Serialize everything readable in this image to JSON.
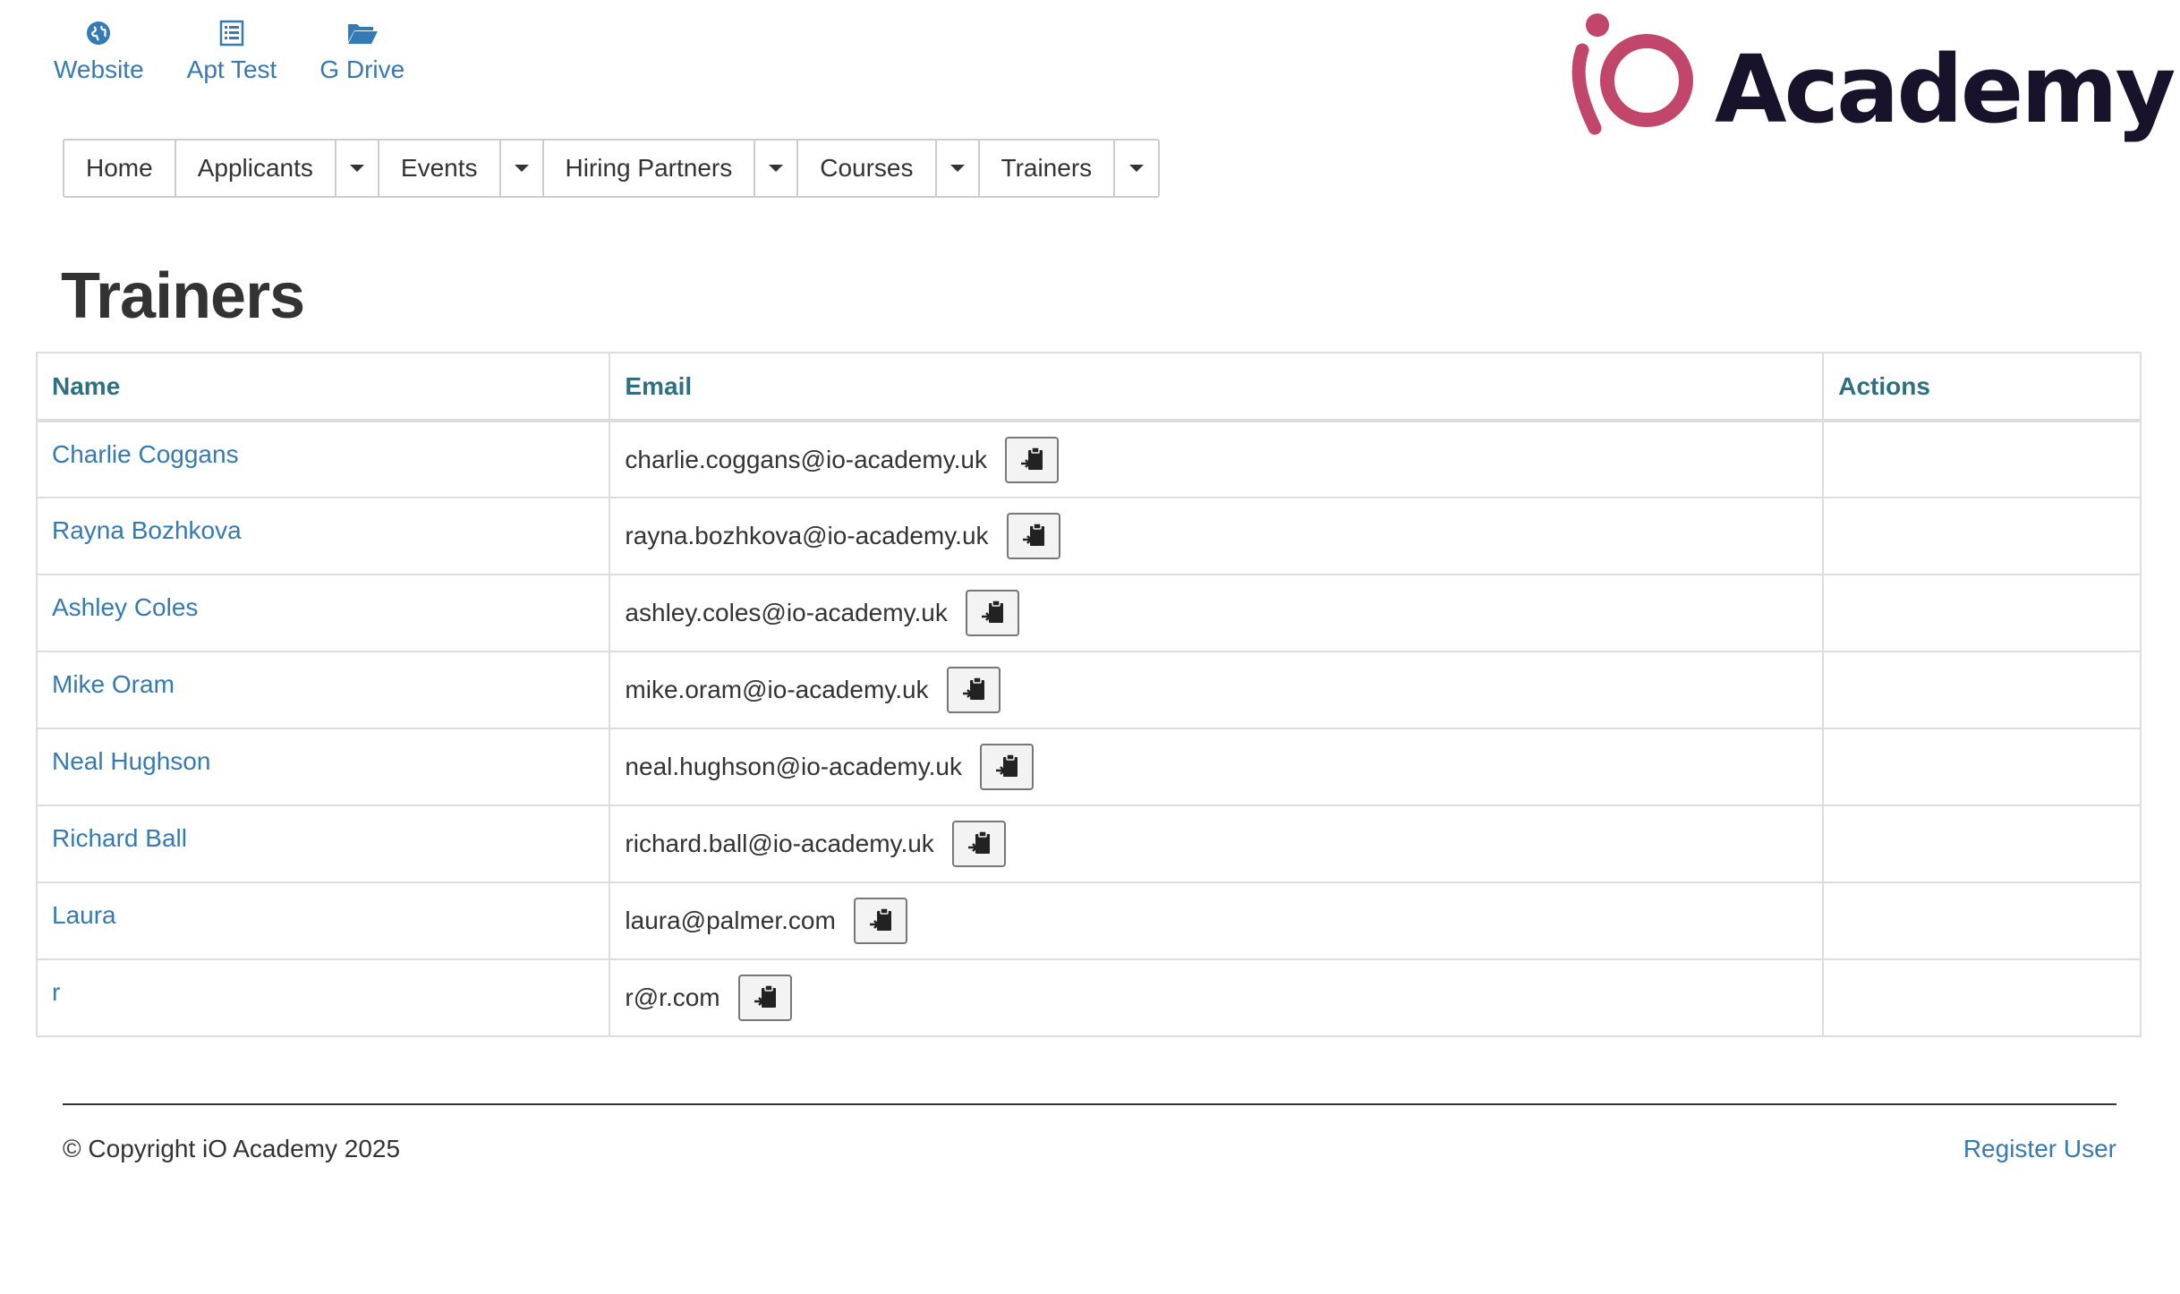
{
  "quick_links": [
    {
      "label": "Website",
      "icon": "globe-icon"
    },
    {
      "label": "Apt Test",
      "icon": "list-icon"
    },
    {
      "label": "G Drive",
      "icon": "folder-open-icon"
    }
  ],
  "logo": {
    "text": "Academy",
    "mark": "iO",
    "brand_color": "#c2456b",
    "text_color": "#18122b"
  },
  "nav": {
    "home": "Home",
    "applicants": "Applicants",
    "events": "Events",
    "hiring_partners": "Hiring Partners",
    "courses": "Courses",
    "trainers": "Trainers"
  },
  "page": {
    "title": "Trainers"
  },
  "table": {
    "headers": {
      "name": "Name",
      "email": "Email",
      "actions": "Actions"
    },
    "rows": [
      {
        "name": "Charlie Coggans",
        "email": "charlie.coggans@io-academy.uk"
      },
      {
        "name": "Rayna Bozhkova",
        "email": "rayna.bozhkova@io-academy.uk"
      },
      {
        "name": "Ashley Coles",
        "email": "ashley.coles@io-academy.uk"
      },
      {
        "name": "Mike Oram",
        "email": "mike.oram@io-academy.uk"
      },
      {
        "name": "Neal Hughson",
        "email": "neal.hughson@io-academy.uk"
      },
      {
        "name": "Richard Ball",
        "email": "richard.ball@io-academy.uk"
      },
      {
        "name": "Laura",
        "email": "laura@palmer.com"
      },
      {
        "name": "r",
        "email": "r@r.com"
      }
    ]
  },
  "footer": {
    "copyright": "© Copyright iO Academy 2025",
    "register": "Register User"
  },
  "colors": {
    "link": "#337ab7",
    "header_text": "#2e6f82",
    "border": "#dddddd"
  }
}
